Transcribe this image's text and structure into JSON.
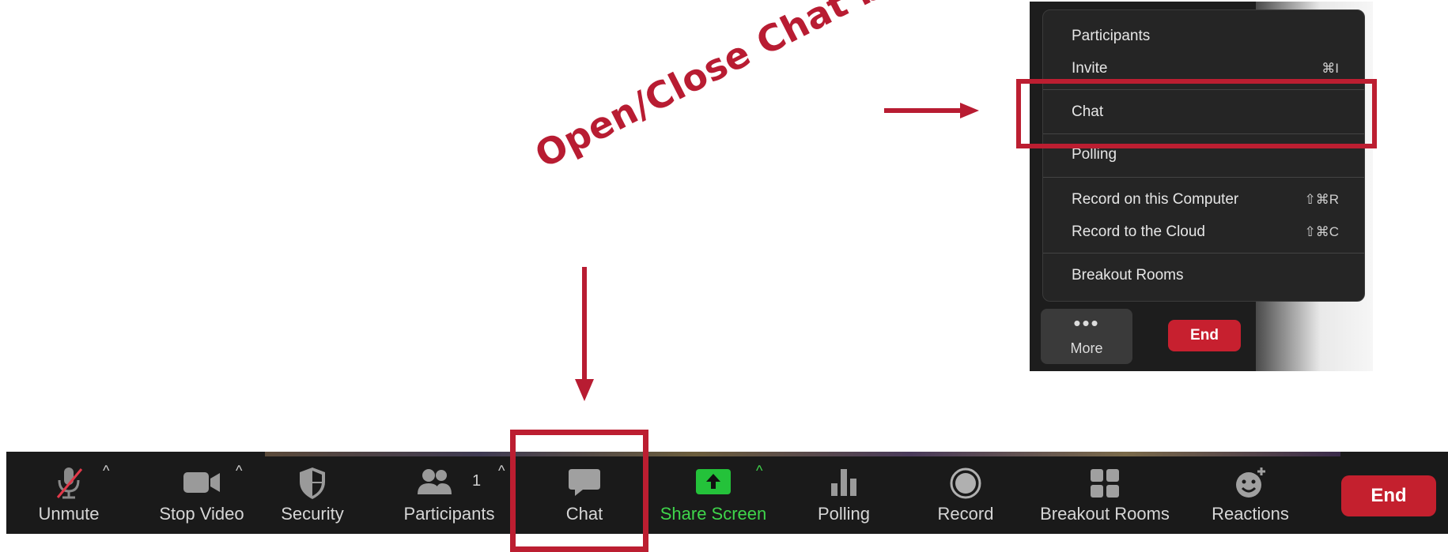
{
  "annotation": {
    "label": "Open/Close Chat box"
  },
  "more_menu": {
    "items": [
      {
        "label": "Participants",
        "shortcut": ""
      },
      {
        "label": "Invite",
        "shortcut": "⌘I"
      },
      {
        "label": "Chat",
        "shortcut": ""
      },
      {
        "label": "Polling",
        "shortcut": ""
      },
      {
        "label": "Record on this Computer",
        "shortcut": "⇧⌘R"
      },
      {
        "label": "Record to the Cloud",
        "shortcut": "⇧⌘C"
      },
      {
        "label": "Breakout Rooms",
        "shortcut": ""
      }
    ],
    "more_label": "More",
    "end_label": "End"
  },
  "toolbar": {
    "unmute": "Unmute",
    "stop_video": "Stop Video",
    "security": "Security",
    "participants": "Participants",
    "participant_count": "1",
    "chat": "Chat",
    "share_screen": "Share Screen",
    "polling": "Polling",
    "record": "Record",
    "breakout_rooms": "Breakout Rooms",
    "reactions": "Reactions",
    "end": "End"
  },
  "colors": {
    "annotation": "#b81c32",
    "share_green": "#3fd54b",
    "end_red": "#c4202e"
  }
}
